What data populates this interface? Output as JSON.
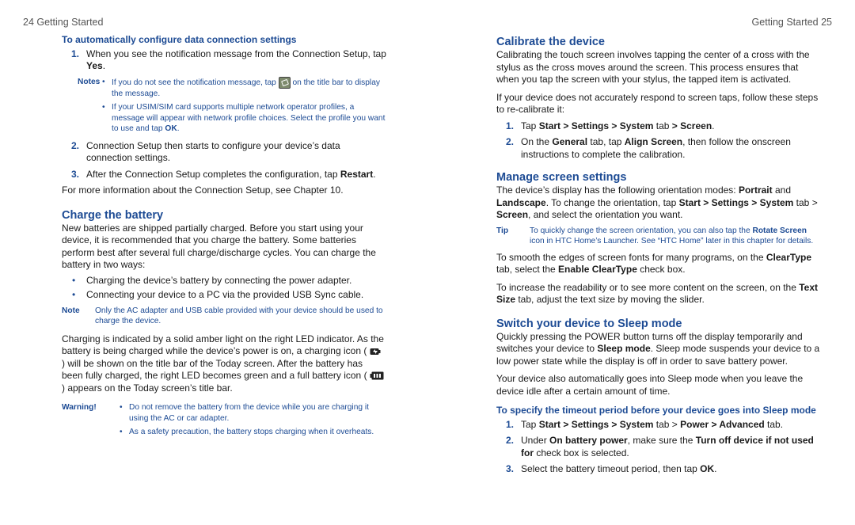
{
  "left_page": {
    "running_head": "24  Getting Started",
    "procedure_title": "To automatically configure data connection settings",
    "step1": {
      "num": "1.",
      "pre": "When you see the notification message from the Connection Setup, tap ",
      "bold": "Yes",
      "post": "."
    },
    "notes_label": "Notes",
    "note1": {
      "pre": "If you do not see the notification message, tap ",
      "post": " on the title bar to display the message.",
      "icon": "notification-icon"
    },
    "note2": {
      "pre": "If your USIM/SIM card supports multiple network operator profiles, a message will appear with network profile choices. Select the profile you want to use and tap ",
      "bold": "OK",
      "post": "."
    },
    "step2": {
      "num": "2.",
      "text": "Connection Setup then starts to configure your device’s data connection settings."
    },
    "step3": {
      "num": "3.",
      "pre": "After the Connection Setup completes the configuration, tap ",
      "bold": "Restart",
      "post": "."
    },
    "more_info": "For more information about the Connection Setup, see Chapter 10.",
    "charge_heading": "Charge the battery",
    "charge_intro": "New batteries are shipped partially charged. Before you start using your device, it is recommended that you charge the battery. Some batteries perform best after several full charge/discharge cycles. You can charge the battery in two ways:",
    "charge_bullets": [
      "Charging the device’s battery by connecting the power adapter.",
      "Connecting your device to a PC via the provided USB Sync cable."
    ],
    "note_label": "Note",
    "note_text": "Only the AC adapter and USB cable provided with your device should be used to charge the device.",
    "charging_para": {
      "a": "Charging is indicated by a solid amber light on the right LED indicator. As the battery is being charged while the device’s power is on, a charging icon ( ",
      "b": " ) will be shown on the title bar of the Today screen. After the battery has been fully charged, the right LED becomes green and a full battery icon ( ",
      "c": " ) appears on the Today screen’s title bar.",
      "icon1": "charging-icon",
      "icon2": "full-battery-icon"
    },
    "warning_label": "Warning!",
    "warnings": [
      "Do not remove the battery from the device while you are charging it using the AC or car adapter.",
      "As a safety precaution, the battery stops charging when it overheats."
    ]
  },
  "right_page": {
    "running_head": "Getting Started  25",
    "calibrate_heading": "Calibrate the device",
    "calibrate_p1": "Calibrating the touch screen involves tapping the center of a cross with the stylus as the cross moves around the screen. This process ensures that when you tap the screen with your stylus, the tapped item is activated.",
    "calibrate_p2": "If your device does not accurately respond to screen taps, follow these steps to re-calibrate it:",
    "cal_step1": {
      "num": "1.",
      "t1": "Tap ",
      "b1": "Start > Settings > System",
      "t2": " tab ",
      "b2": "> Screen",
      "t3": "."
    },
    "cal_step2": {
      "num": "2.",
      "t1": "On the ",
      "b1": "General",
      "t2": " tab, tap ",
      "b2": "Align Screen",
      "t3": ", then follow the onscreen instructions to complete the calibration."
    },
    "manage_heading": "Manage screen settings",
    "manage_p1": {
      "t1": "The device’s display has the following orientation modes: ",
      "b1": "Portrait",
      "t2": " and ",
      "b2": "Landscape",
      "t3": ". To change the orientation, tap ",
      "b3": "Start > Settings > System",
      "t4": " tab > ",
      "b4": "Screen",
      "t5": ", and select the orientation you want."
    },
    "tip_label": "Tip",
    "tip": {
      "t1": "To quickly change the screen orientation, you can also tap the ",
      "b1": "Rotate Screen",
      "t2": " icon in HTC Home’s Launcher. See “HTC Home” later in this chapter for details."
    },
    "manage_p2": {
      "t1": "To smooth the edges of screen fonts for many programs, on the ",
      "b1": "ClearType",
      "t2": " tab, select the ",
      "b2": "Enable ClearType",
      "t3": " check box."
    },
    "manage_p3": {
      "t1": "To increase the readability or to see more content on the screen, on the ",
      "b1": "Text Size",
      "t2": " tab, adjust the text size by moving the slider."
    },
    "sleep_heading": "Switch your device to Sleep mode",
    "sleep_p1": {
      "t1": "Quickly pressing the POWER button turns off the display temporarily and switches your device to ",
      "b1": "Sleep mode",
      "t2": ". Sleep mode suspends your device to a low power state while the display is off in order to save battery power."
    },
    "sleep_p2": "Your device also automatically goes into Sleep mode when you leave the device idle after a certain amount of time.",
    "timeout_title": "To specify the timeout period before your device goes into Sleep mode",
    "to_step1": {
      "num": "1.",
      "t1": "Tap ",
      "b1": "Start > Settings > System",
      "t2": " tab > ",
      "b2": "Power > Advanced",
      "t3": " tab."
    },
    "to_step2": {
      "num": "2.",
      "t1": "Under ",
      "b1": "On battery power",
      "t2": ", make sure the ",
      "b2": "Turn off device if not used for",
      "t3": " check box is selected."
    },
    "to_step3": {
      "num": "3.",
      "t1": "Select the battery timeout period, then tap ",
      "b1": "OK",
      "t2": "."
    }
  },
  "colors": {
    "heading_blue": "#1d4b94",
    "body_text": "#1a1a1a",
    "running_head": "#555555"
  },
  "bullet_glyph": "•"
}
